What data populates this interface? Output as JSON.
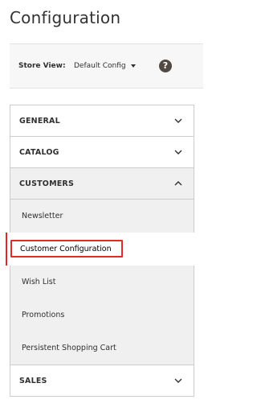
{
  "page": {
    "title": "Configuration"
  },
  "store_view": {
    "label": "Store View:",
    "selected": "Default Config",
    "help": "?"
  },
  "sections": {
    "general": "GENERAL",
    "catalog": "CATALOG",
    "customers": "CUSTOMERS",
    "sales": "SALES"
  },
  "customers_items": {
    "newsletter": "Newsletter",
    "customer_configuration": "Customer Configuration",
    "wish_list": "Wish List",
    "promotions": "Promotions",
    "persistent_shopping_cart": "Persistent Shopping Cart"
  },
  "colors": {
    "highlight": "#e02b27",
    "panel": "#f0f0f0"
  }
}
